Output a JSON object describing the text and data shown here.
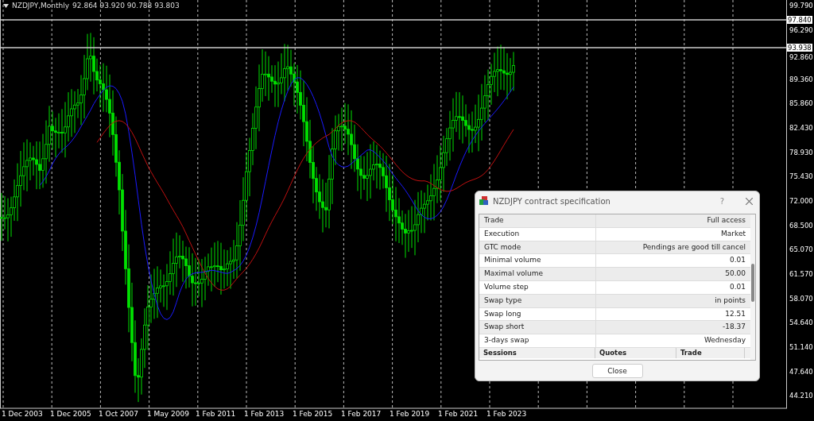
{
  "chart": {
    "title": "NZDJPY,Monthly",
    "ohlc": "92.864 93.920 90.788 93.803",
    "price_labels": [
      {
        "text": "99.790",
        "marked": false
      },
      {
        "text": "97.840",
        "marked": true
      },
      {
        "text": "96.290",
        "marked": false
      },
      {
        "text": "93.938",
        "marked": true
      },
      {
        "text": "92.860",
        "marked": false
      },
      {
        "text": "89.360",
        "marked": false
      },
      {
        "text": "85.860",
        "marked": false
      },
      {
        "text": "82.430",
        "marked": false
      },
      {
        "text": "78.930",
        "marked": false
      },
      {
        "text": "75.430",
        "marked": false
      },
      {
        "text": "72.000",
        "marked": false
      },
      {
        "text": "68.500",
        "marked": false
      },
      {
        "text": "65.070",
        "marked": false
      },
      {
        "text": "61.570",
        "marked": false
      },
      {
        "text": "58.070",
        "marked": false
      },
      {
        "text": "54.640",
        "marked": false
      },
      {
        "text": "51.140",
        "marked": false
      },
      {
        "text": "47.640",
        "marked": false
      },
      {
        "text": "44.210",
        "marked": false
      }
    ],
    "date_labels": [
      "1 Dec 2003",
      "1 Dec 2005",
      "1 Oct 2007",
      "1 May 2009",
      "1 Feb 2011",
      "1 Feb 2013",
      "1 Feb 2015",
      "1 Feb 2017",
      "1 Feb 2019",
      "1 Feb 2021",
      "1 Feb 2023"
    ]
  },
  "dialog": {
    "title": "NZDJPY contract specification",
    "help": "?",
    "rows": [
      {
        "label": "Trade",
        "value": "Full access"
      },
      {
        "label": "Execution",
        "value": "Market"
      },
      {
        "label": "GTC mode",
        "value": "Pendings are good till cancel"
      },
      {
        "label": "Minimal volume",
        "value": "0.01"
      },
      {
        "label": "Maximal volume",
        "value": "50.00"
      },
      {
        "label": "Volume step",
        "value": "0.01"
      },
      {
        "label": "Swap type",
        "value": "in points"
      },
      {
        "label": "Swap long",
        "value": "12.51"
      },
      {
        "label": "Swap short",
        "value": "-18.37"
      },
      {
        "label": "3-days swap",
        "value": "Wednesday"
      }
    ],
    "columns": [
      "Sessions",
      "Quotes",
      "Trade"
    ],
    "button": "Close"
  }
}
